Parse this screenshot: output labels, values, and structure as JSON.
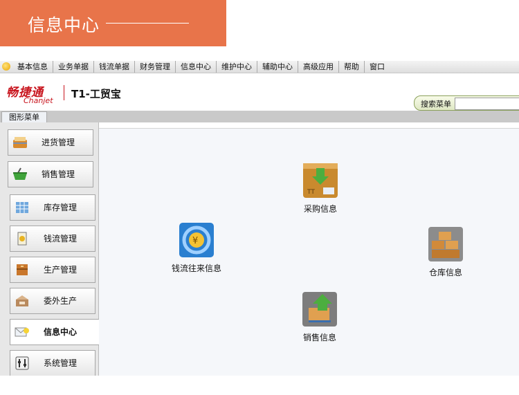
{
  "banner": {
    "title": "信息中心"
  },
  "menubar": {
    "items": [
      "基本信息",
      "业务单据",
      "钱流单据",
      "财务管理",
      "信息中心",
      "维护中心",
      "辅助中心",
      "高级应用",
      "帮助",
      "窗口"
    ]
  },
  "brand": {
    "cn": "畅捷通",
    "en": "Chanjet",
    "product": "T1-工贸宝"
  },
  "search": {
    "label": "搜索菜单",
    "value": ""
  },
  "tabs": {
    "active": "图形菜单"
  },
  "sidebar": {
    "items": [
      {
        "label": "进货管理",
        "icon": "purchase-basket-icon"
      },
      {
        "label": "销售管理",
        "icon": "sales-basket-icon"
      },
      {
        "label": "库存管理",
        "icon": "inventory-icon"
      },
      {
        "label": "钱流管理",
        "icon": "money-flow-icon"
      },
      {
        "label": "生产管理",
        "icon": "production-icon"
      },
      {
        "label": "委外生产",
        "icon": "outsource-icon"
      },
      {
        "label": "信息中心",
        "icon": "info-center-icon",
        "active": true
      },
      {
        "label": "系统管理",
        "icon": "system-settings-icon"
      }
    ]
  },
  "canvas": {
    "purchase": "采购信息",
    "moneyflow": "钱流往来信息",
    "warehouse": "仓库信息",
    "sales": "销售信息"
  },
  "colors": {
    "banner": "#e8744a",
    "brand_red": "#c8141d",
    "accent_blue": "#2a7fd0"
  }
}
